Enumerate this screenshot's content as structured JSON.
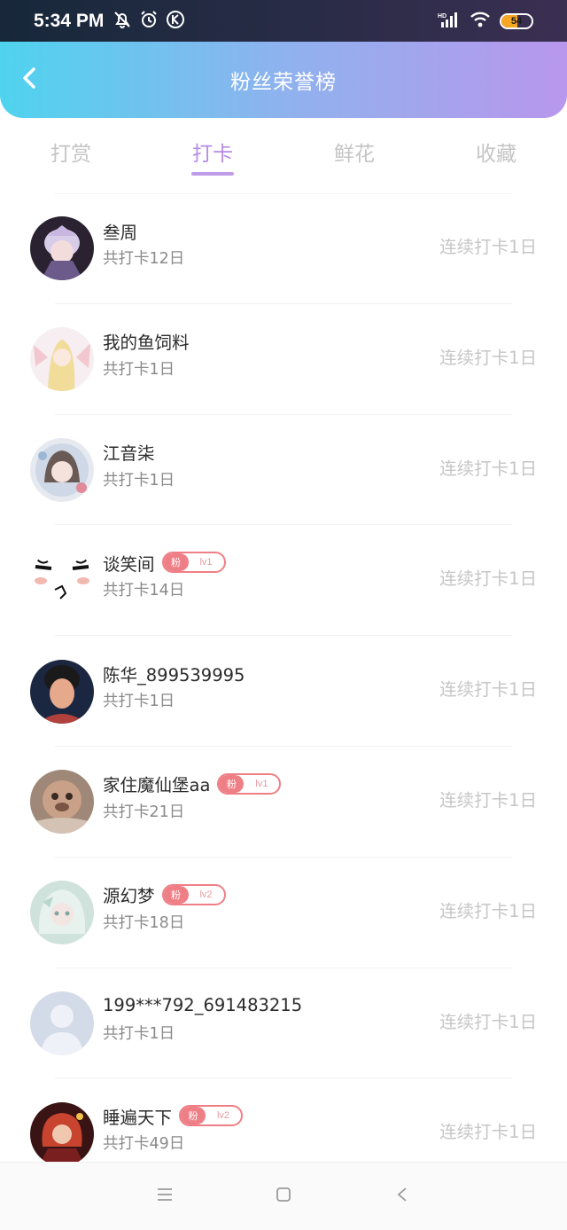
{
  "status_bar": {
    "time": "5:34 PM",
    "battery": "54",
    "icons": [
      "mute-bell-icon",
      "alarm-icon",
      "k-app-icon",
      "hd-signal-icon",
      "wifi-icon",
      "battery-icon"
    ]
  },
  "header": {
    "title": "粉丝荣誉榜",
    "back_icon": "chevron-left-icon"
  },
  "tabs": [
    {
      "label": "打赏",
      "active": false
    },
    {
      "label": "打卡",
      "active": true
    },
    {
      "label": "鲜花",
      "active": false
    },
    {
      "label": "收藏",
      "active": false
    }
  ],
  "rows": [
    {
      "name": "叁周",
      "total": "共打卡12日",
      "streak": "连续打卡1日"
    },
    {
      "name": "我的鱼饲料",
      "total": "共打卡1日",
      "streak": "连续打卡1日"
    },
    {
      "name": "江音柒",
      "total": "共打卡1日",
      "streak": "连续打卡1日"
    },
    {
      "name": "谈笑间",
      "badge_tag": "粉",
      "badge_level": "lv1",
      "total": "共打卡14日",
      "streak": "连续打卡1日"
    },
    {
      "name": "陈华_899539995",
      "total": "共打卡1日",
      "streak": "连续打卡1日"
    },
    {
      "name": "家住魔仙堡aa",
      "badge_tag": "粉",
      "badge_level": "lv1",
      "total": "共打卡21日",
      "streak": "连续打卡1日"
    },
    {
      "name": "源幻梦",
      "badge_tag": "粉",
      "badge_level": "lv2",
      "total": "共打卡18日",
      "streak": "连续打卡1日"
    },
    {
      "name": "199***792_691483215",
      "total": "共打卡1日",
      "streak": "连续打卡1日"
    },
    {
      "name": "睡遍天下",
      "badge_tag": "粉",
      "badge_level": "lv2",
      "total": "共打卡49日",
      "streak": "连续打卡1日"
    }
  ],
  "nav_bar": {
    "icons": [
      "menu-icon",
      "home-square-icon",
      "back-triangle-icon"
    ]
  },
  "colors": {
    "header_gradient_start": "#4fd3ef",
    "header_gradient_end": "#b897ec",
    "active_tab": "#b58be6",
    "badge": "#ef7f86"
  }
}
